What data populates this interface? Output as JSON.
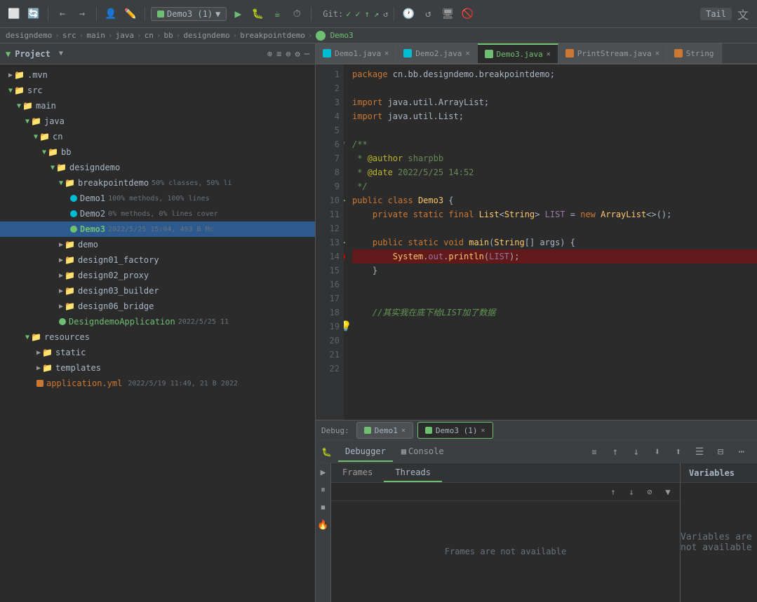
{
  "toolbar": {
    "dropdown_label": "Demo3 (1)",
    "git_label": "Git:",
    "tail_label": "Tail",
    "translate_icon": "A»",
    "buttons": [
      "⬜",
      "🔄",
      "←",
      "→",
      "🔑",
      "✏️",
      "▶",
      "🐛",
      "🔨",
      "☕",
      "⏱",
      "Git:",
      "✓✓↑↗↺",
      "🚫",
      "Tail",
      "🌐"
    ]
  },
  "breadcrumb": {
    "items": [
      "designdemo",
      "src",
      "main",
      "java",
      "cn",
      "bb",
      "designdemo",
      "breakpointdemo",
      "Demo3"
    ]
  },
  "project": {
    "title": "Project",
    "tree": [
      {
        "id": "mvn",
        "label": ".mvn",
        "type": "folder",
        "indent": 1,
        "expanded": false
      },
      {
        "id": "src",
        "label": "src",
        "type": "folder",
        "indent": 1,
        "expanded": true
      },
      {
        "id": "main",
        "label": "main",
        "type": "folder",
        "indent": 2,
        "expanded": true
      },
      {
        "id": "java",
        "label": "java",
        "type": "folder",
        "indent": 3,
        "expanded": true
      },
      {
        "id": "cn",
        "label": "cn",
        "type": "folder",
        "indent": 4,
        "expanded": true
      },
      {
        "id": "bb",
        "label": "bb",
        "type": "folder",
        "indent": 5,
        "expanded": true
      },
      {
        "id": "designdemo",
        "label": "designdemo",
        "type": "folder",
        "indent": 6,
        "expanded": true
      },
      {
        "id": "breakpointdemo",
        "label": "breakpointdemo",
        "type": "folder",
        "indent": 7,
        "expanded": true,
        "meta": "50% classes, 50% li"
      },
      {
        "id": "demo1",
        "label": "Demo1",
        "type": "java-cyan",
        "indent": 8,
        "meta": "100% methods, 100% lines"
      },
      {
        "id": "demo2",
        "label": "Demo2",
        "type": "java-cyan",
        "indent": 8,
        "meta": "0% methods, 0% lines cover"
      },
      {
        "id": "demo3",
        "label": "Demo3",
        "type": "java-green",
        "indent": 8,
        "meta": "2022/5/25 15:04, 493 B Mc",
        "selected": true
      },
      {
        "id": "demo",
        "label": "demo",
        "type": "folder",
        "indent": 7,
        "expanded": false
      },
      {
        "id": "design01_factory",
        "label": "design01_factory",
        "type": "folder",
        "indent": 7,
        "expanded": false
      },
      {
        "id": "design02_proxy",
        "label": "design02_proxy",
        "type": "folder",
        "indent": 7,
        "expanded": false
      },
      {
        "id": "design03_builder",
        "label": "design03_builder",
        "type": "folder",
        "indent": 7,
        "expanded": false
      },
      {
        "id": "design06_bridge",
        "label": "design06_bridge",
        "type": "folder",
        "indent": 7,
        "expanded": false
      },
      {
        "id": "DesigndemoApplication",
        "label": "DesigndemoApplication",
        "type": "java-green",
        "indent": 7,
        "meta": "2022/5/25 11"
      },
      {
        "id": "resources",
        "label": "resources",
        "type": "folder",
        "indent": 3,
        "expanded": true
      },
      {
        "id": "static",
        "label": "static",
        "type": "folder",
        "indent": 4,
        "expanded": false
      },
      {
        "id": "templates",
        "label": "templates",
        "type": "folder",
        "indent": 4,
        "expanded": false
      },
      {
        "id": "application_yml",
        "label": "application.yml",
        "type": "yml",
        "indent": 4,
        "meta": "2022/5/19 11:49, 21 B 2022"
      }
    ]
  },
  "editor": {
    "tabs": [
      {
        "label": "Demo1.java",
        "type": "cyan",
        "active": false
      },
      {
        "label": "Demo2.java",
        "type": "cyan",
        "active": false
      },
      {
        "label": "Demo3.java",
        "type": "green",
        "active": true
      },
      {
        "label": "PrintStream.java",
        "type": "orange",
        "active": false
      },
      {
        "label": "String",
        "type": "orange",
        "active": false
      }
    ],
    "lines": [
      {
        "num": 1,
        "code": "package cn.bb.designdemo.breakpointdemo;",
        "type": "plain"
      },
      {
        "num": 2,
        "code": "",
        "type": "plain"
      },
      {
        "num": 3,
        "code": "import java.util.ArrayList;",
        "type": "import"
      },
      {
        "num": 4,
        "code": "import java.util.List;",
        "type": "import"
      },
      {
        "num": 5,
        "code": "",
        "type": "plain"
      },
      {
        "num": 6,
        "code": "/**",
        "type": "comment"
      },
      {
        "num": 7,
        "code": " * @author sharpbb",
        "type": "comment-author"
      },
      {
        "num": 8,
        "code": " * @date 2022/5/25 14:52",
        "type": "comment-date"
      },
      {
        "num": 9,
        "code": " */",
        "type": "comment"
      },
      {
        "num": 10,
        "code": "public class Demo3 {",
        "type": "class",
        "has_arrow": true
      },
      {
        "num": 11,
        "code": "    private static final List<String> LIST = new ArrayList<>();",
        "type": "field"
      },
      {
        "num": 12,
        "code": "",
        "type": "plain"
      },
      {
        "num": 13,
        "code": "    public static void main(String[] args) {",
        "type": "method",
        "has_arrow": true
      },
      {
        "num": 14,
        "code": "        System.out.println(LIST);",
        "type": "call",
        "breakpoint": true
      },
      {
        "num": 15,
        "code": "    }",
        "type": "plain"
      },
      {
        "num": 16,
        "code": "",
        "type": "plain"
      },
      {
        "num": 17,
        "code": "",
        "type": "plain"
      },
      {
        "num": 18,
        "code": "    //其实我在底下给LIST加了数据",
        "type": "comment-cn"
      },
      {
        "num": 19,
        "code": "",
        "type": "plain",
        "has_bulb": true
      },
      {
        "num": 20,
        "code": "",
        "type": "plain"
      },
      {
        "num": 21,
        "code": "",
        "type": "plain"
      },
      {
        "num": 22,
        "code": "",
        "type": "plain"
      }
    ]
  },
  "debug": {
    "label": "Debug:",
    "sessions": [
      {
        "label": "Demo1",
        "active": false
      },
      {
        "label": "Demo3 (1)",
        "active": true
      }
    ],
    "toolbar_tabs": [
      {
        "label": "Debugger",
        "icon": "🐛",
        "active": true
      },
      {
        "label": "Console",
        "icon": "▦",
        "active": false
      }
    ],
    "toolbar_buttons": [
      "↑",
      "↓",
      "⬇",
      "▽",
      "⬆",
      "☰",
      "⊟",
      "⋯"
    ],
    "frames_threads_tabs": [
      {
        "label": "Frames",
        "active": false
      },
      {
        "label": "Threads",
        "active": true
      }
    ],
    "frames_empty_msg": "Frames are not available",
    "variables_title": "Variables",
    "variables_empty_msg": "Variables are not available"
  }
}
